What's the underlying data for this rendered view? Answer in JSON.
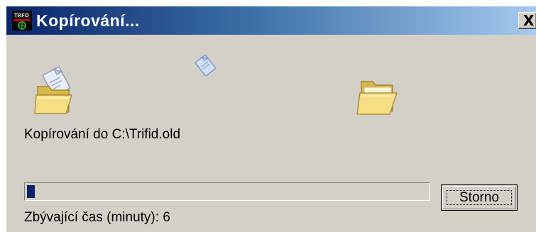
{
  "window": {
    "title": "Kopírování...",
    "close_label": "X",
    "app_icon": "trifid-app-icon"
  },
  "animation": {
    "source_icon": "folder-open-with-document-icon",
    "flying_icon": "flying-document-icon",
    "destination_icon": "folder-open-icon"
  },
  "status": {
    "text": "Kopírování do C:\\Trifid.old"
  },
  "progress": {
    "percent": 2
  },
  "buttons": {
    "storno_label": "Storno"
  },
  "time": {
    "text": "Zbývající čas (minuty): 6"
  },
  "colors": {
    "title_start": "#0a246a",
    "title_end": "#a6caf0",
    "progress_fill": "#0a246a",
    "dialog_bg": "#d4d0c8"
  }
}
